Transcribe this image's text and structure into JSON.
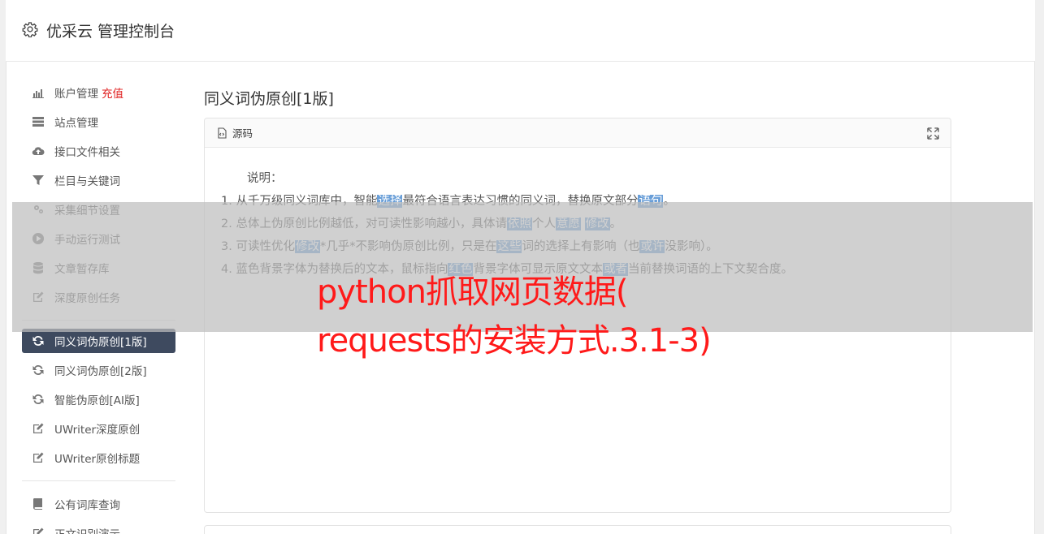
{
  "header": {
    "title": "优采云 管理控制台",
    "icon": "gear-icon"
  },
  "sidebar": {
    "group1": [
      {
        "label": "账户管理",
        "badge": "充值",
        "icon": "bar-chart-icon"
      },
      {
        "label": "站点管理",
        "icon": "server-icon"
      },
      {
        "label": "接口文件相关",
        "icon": "cloud-upload-icon"
      },
      {
        "label": "栏目与关键词",
        "icon": "filter-icon"
      },
      {
        "label": "采集细节设置",
        "icon": "gears-icon"
      },
      {
        "label": "手动运行测试",
        "icon": "play-circle-icon"
      },
      {
        "label": "文章暂存库",
        "icon": "database-icon"
      },
      {
        "label": "深度原创任务",
        "icon": "edit-icon"
      }
    ],
    "group2": [
      {
        "label": "同义词伪原创[1版]",
        "icon": "refresh-icon",
        "active": true
      },
      {
        "label": "同义词伪原创[2版]",
        "icon": "refresh-icon"
      },
      {
        "label": "智能伪原创[AI版]",
        "icon": "refresh-icon"
      },
      {
        "label": "UWriter深度原创",
        "icon": "edit-icon"
      },
      {
        "label": "UWriter原创标题",
        "icon": "edit-icon"
      }
    ],
    "group3": [
      {
        "label": "公有词库查询",
        "icon": "book-icon"
      },
      {
        "label": "正文识别演示",
        "icon": "edit-icon"
      }
    ]
  },
  "main": {
    "title": "同义词伪原创[1版]",
    "panel": {
      "head": "源码",
      "note_title": "说明：",
      "lines": [
        [
          "1. 从千万级同义词库中，智能",
          {
            "hl": "选择"
          },
          "最符合语言表达习惯的同义词，替换原文部分",
          {
            "hl": "语句"
          },
          "。"
        ],
        [
          "2. 总体上伪原创比例越低，对可读性影响越小，具体请",
          {
            "hl": "依照"
          },
          "个人",
          {
            "hl": "意愿"
          },
          " ",
          {
            "hl": "修改"
          },
          "。"
        ],
        [
          "3. 可读性优化",
          {
            "hl": "修改"
          },
          "*几乎*不影响伪原创比例，只是在",
          {
            "hl": "这些"
          },
          "词的选择上有影响（也",
          {
            "hl": "或许"
          },
          "没影响）。"
        ],
        [
          "4. 蓝色背景字体为替换后的文本，鼠标指向",
          {
            "hl": "红色"
          },
          "背景字体可显示原文文本",
          {
            "hl": "或者"
          },
          "当前替换词语的上下文契合度。"
        ]
      ]
    }
  },
  "overlay": {
    "line1": "python抓取网页数据(",
    "line2": "requests的安装方式.3.1-3)"
  }
}
